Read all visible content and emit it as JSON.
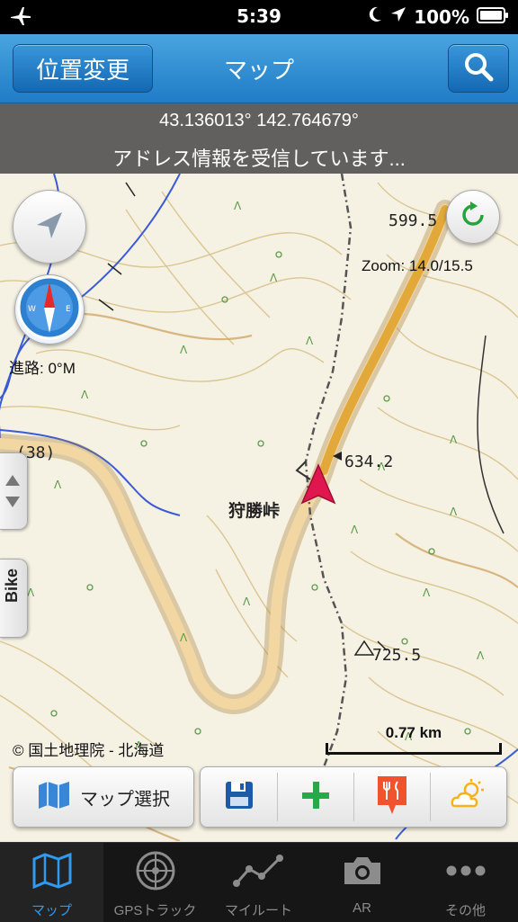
{
  "status_bar": {
    "time": "5:39",
    "battery": "100%"
  },
  "nav": {
    "location_button": "位置変更",
    "title": "マップ"
  },
  "coords": {
    "latlon": "43.136013° 142.764679°",
    "address_status": "アドレス情報を受信しています..."
  },
  "map": {
    "zoom_text": "Zoom: 14.0/15.5",
    "heading_text": "進路: 0°M",
    "place_name": "狩勝峠",
    "elevations": [
      "599.5",
      "634.2",
      "725.5"
    ],
    "route_no": "(38)",
    "copyright": "© 国土地理院 - 北海道",
    "scale": "0.77 km",
    "side_tab_label": "Bike"
  },
  "toolbar": {
    "map_select_label": "マップ選択"
  },
  "tabs": [
    {
      "label": "マップ",
      "icon": "map-icon",
      "active": true
    },
    {
      "label": "GPSトラック",
      "icon": "radar-icon",
      "active": false
    },
    {
      "label": "マイルート",
      "icon": "route-icon",
      "active": false
    },
    {
      "label": "AR",
      "icon": "camera-icon",
      "active": false
    },
    {
      "label": "その他",
      "icon": "more-icon",
      "active": false
    }
  ],
  "colors": {
    "accent": "#2f9af0",
    "nav_blue": "#1f7cc6",
    "road_orange": "#e7b25c",
    "position_marker": "#e0174f"
  }
}
